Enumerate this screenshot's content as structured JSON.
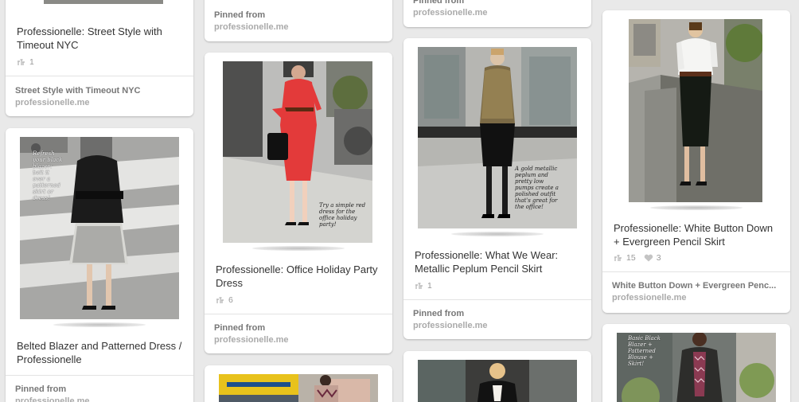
{
  "pins": {
    "street_style": {
      "title": "Professionelle: Street Style with Timeout NYC",
      "repins": "1",
      "board": "Street Style with Timeout NYC",
      "source": "professionelle.me"
    },
    "belted_blazer": {
      "title": "Belted Blazer and Patterned Dress / Professionelle",
      "caption": "Refresh your black blazer: belt it over a patterned skirt or dress!",
      "pinned_label": "Pinned from",
      "source": "professionelle.me"
    },
    "col2_top": {
      "pinned_label": "Pinned from",
      "source": "professionelle.me"
    },
    "office_holiday": {
      "title": "Professionelle: Office Holiday Party Dress",
      "caption": "Try a simple red dress for the office holiday party!",
      "repins": "6",
      "pinned_label": "Pinned from",
      "source": "professionelle.me"
    },
    "col3_top": {
      "pinned_label": "Pinned from",
      "source": "professionelle.me"
    },
    "metallic_peplum": {
      "title": "Professionelle: What We Wear: Metallic Peplum Pencil Skirt",
      "caption": "A gold metallic peplum and pretty low pumps create a polished outfit that's great for the office!",
      "repins": "1",
      "pinned_label": "Pinned from",
      "source": "professionelle.me"
    },
    "white_button": {
      "title": "Professionelle: White Button Down + Evergreen Pencil Skirt",
      "repins": "15",
      "likes": "3",
      "board": "White Button Down + Evergreen Penc...",
      "source": "professionelle.me"
    },
    "basic_black": {
      "caption": "Basic Black Blazer + Patterned Blouse + Skirt!"
    }
  },
  "icons": {
    "repin": "repin-icon",
    "like": "heart-icon"
  },
  "colors": {
    "background": "#e9e9e9",
    "card": "#ffffff",
    "title": "#333333",
    "meta": "#999999"
  }
}
